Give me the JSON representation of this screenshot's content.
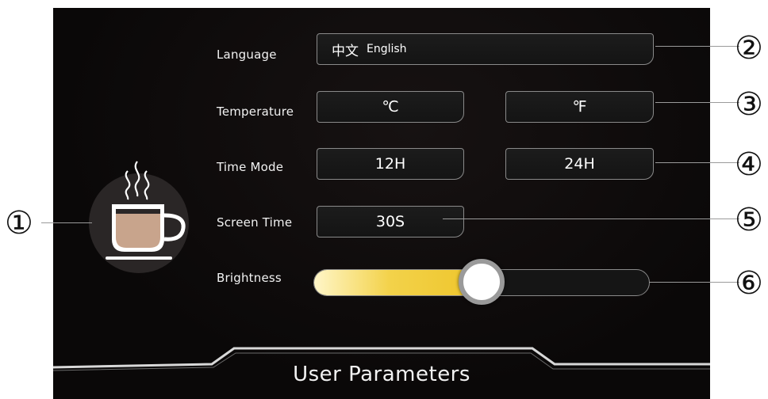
{
  "language": {
    "label": "Language",
    "options": [
      "中文",
      "English"
    ]
  },
  "temperature": {
    "label": "Temperature",
    "celsius": "℃",
    "fahrenheit": "℉"
  },
  "time_mode": {
    "label": "Time Mode",
    "option_12": "12H",
    "option_24": "24H"
  },
  "screen_time": {
    "label": "Screen Time",
    "value": "30S"
  },
  "brightness": {
    "label": "Brightness",
    "level_percent": 50
  },
  "footer": {
    "title": "User Parameters"
  },
  "callouts": [
    "①",
    "②",
    "③",
    "④",
    "⑤",
    "⑥"
  ],
  "colors": {
    "accent": "#eec52a",
    "cup_fill": "#c8a48c",
    "cup_outline": "#ffffff",
    "panel_bg": "#0a0808",
    "circle_bg": "#2a2626"
  },
  "icons": {
    "cup": "coffee-cup-icon"
  }
}
